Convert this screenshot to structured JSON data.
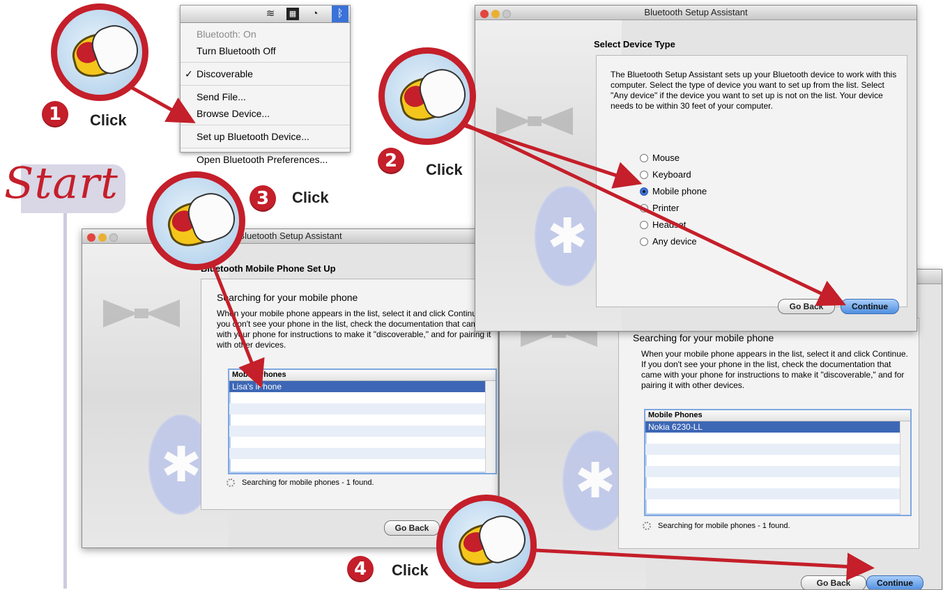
{
  "menu": {
    "bluetooth_status": "Bluetooth: On",
    "turn_off": "Turn Bluetooth Off",
    "discoverable": "Discoverable",
    "discoverable_check": "✓",
    "send_file": "Send File...",
    "browse_device": "Browse Device...",
    "setup_device": "Set up Bluetooth Device...",
    "open_prefs": "Open Bluetooth Preferences...",
    "icons": [
      "wifi-icon",
      "input-menu-icon",
      "time-machine-icon",
      "bluetooth-icon"
    ]
  },
  "start_label": "Start",
  "steps": [
    {
      "number": "1",
      "label": "Click"
    },
    {
      "number": "2",
      "label": "Click"
    },
    {
      "number": "3",
      "label": "Click"
    },
    {
      "number": "4",
      "label": "Click"
    }
  ],
  "window_device_type": {
    "title": "Bluetooth Setup Assistant",
    "heading": "Select Device Type",
    "description": "The Bluetooth Setup Assistant sets up your Bluetooth device to work with this computer. Select the type of device you want to set up from the list. Select \"Any device\" if the device you want to set up is not on the list. Your device needs to be within 30 feet of your computer.",
    "options": [
      "Mouse",
      "Keyboard",
      "Mobile phone",
      "Printer",
      "Headset",
      "Any device"
    ],
    "selected": "Mobile phone",
    "go_back": "Go Back",
    "continue": "Continue"
  },
  "window_phone_setup": {
    "title": "Bluetooth Setup Assistant",
    "heading": "Bluetooth Mobile Phone Set Up",
    "panel_title": "Searching for your mobile phone",
    "description": "When your mobile phone appears in the list, select it and click Continue. If you don't see your phone in the list, check the documentation that came with your phone for instructions to make it \"discoverable,\" and for pairing it with other devices.",
    "list_header": "Mobile Phones",
    "items": [
      "Lisa's iPhone"
    ],
    "status": "Searching for mobile phones - 1 found.",
    "go_back": "Go Back"
  },
  "window_phone_continue": {
    "panel_title": "Searching for your mobile phone",
    "description": "When your mobile phone appears in the list, select it and click Continue. If you don't see your phone in the list, check the documentation that came with your phone for instructions to make it \"discoverable,\" and for pairing it with other devices.",
    "list_header": "Mobile Phones",
    "items": [
      "Nokia 6230-LL"
    ],
    "status": "Searching for mobile phones - 1 found.",
    "go_back": "Go Back",
    "continue": "Continue"
  },
  "colors": {
    "accent_red": "#c41f2a",
    "selection_blue": "#3d67b5",
    "start_tab": "#d9d6e6"
  }
}
